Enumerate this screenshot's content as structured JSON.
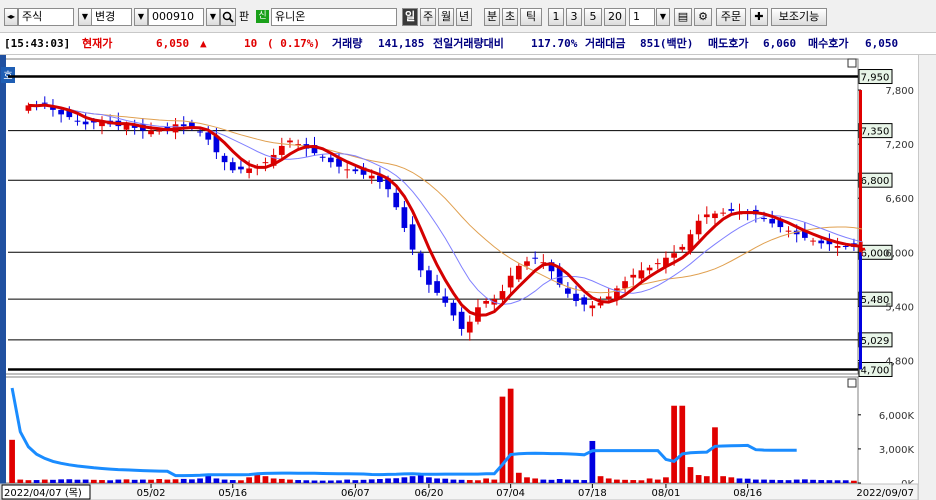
{
  "toolbar": {
    "market_type": "주식",
    "change_button": "변경",
    "stock_code": "000910",
    "search_icon": "search-icon",
    "pan_label": "판",
    "credit_badge": "신",
    "stock_name": "유니온",
    "period_buttons": [
      "일",
      "주",
      "월",
      "년",
      "분",
      "초",
      "틱"
    ],
    "active_period": "일",
    "interval_buttons": [
      "1",
      "3",
      "5",
      "20"
    ],
    "interval_value": "1",
    "order_button": "주문",
    "plus_icon": "plus-icon",
    "aux_button": "보조기능"
  },
  "info": {
    "time": "[15:43:03]",
    "current_label": "현재가",
    "current_price": "6,050",
    "arrow": "▲",
    "change": "10",
    "change_pct": "( 0.17%)",
    "volume_label": "거래량",
    "volume": "141,185",
    "prev_ratio_label": "전일거래량대비",
    "prev_ratio": "117.70%",
    "amount_label": "거래대금",
    "amount": "851(백만)",
    "ask_label": "매도호가",
    "ask": "6,060",
    "bid_label": "매수호가",
    "bid": "6,050"
  },
  "chart_data": {
    "type": "candlestick",
    "price_ticks": [
      "7,800",
      "7,200",
      "6,600",
      "6,000",
      "5,400",
      "4,800"
    ],
    "price_tick_values": [
      7800,
      7200,
      6600,
      6000,
      5400,
      4800
    ],
    "hlines": [
      {
        "label": "7,950",
        "value": 7950
      },
      {
        "label": "7,350",
        "value": 7350
      },
      {
        "label": "6,800",
        "value": 6800
      },
      {
        "label": "6,000",
        "value": 6000
      },
      {
        "label": "5,480",
        "value": 5480
      },
      {
        "label": "5,029",
        "value": 5029
      },
      {
        "label": "4,700",
        "value": 4700
      }
    ],
    "volume_ticks": [
      "6,000K",
      "3,000K",
      "0K"
    ],
    "volume_tick_values": [
      6000,
      3000,
      0
    ],
    "date_labels": [
      "2022/04/07 (목)",
      "05/02",
      "05/16",
      "06/07",
      "06/20",
      "07/04",
      "07/18",
      "08/01",
      "08/16",
      "2022/09/07"
    ],
    "date_label_index": [
      0,
      17,
      27,
      42,
      51,
      61,
      71,
      80,
      90,
      104
    ],
    "n_days": 104,
    "first_candle_index": 2,
    "closes": [
      7630,
      7620,
      7650,
      7580,
      7530,
      7500,
      7450,
      7420,
      7440,
      7460,
      7420,
      7400,
      7420,
      7380,
      7350,
      7350,
      7350,
      7370,
      7420,
      7400,
      7380,
      7330,
      7250,
      7110,
      7000,
      6910,
      6920,
      6930,
      6950,
      7000,
      7080,
      7180,
      7240,
      7200,
      7150,
      7100,
      7050,
      7000,
      6950,
      6920,
      6900,
      6860,
      6850,
      6780,
      6700,
      6500,
      6270,
      6030,
      5800,
      5640,
      5550,
      5440,
      5300,
      5150,
      5230,
      5390,
      5460,
      5480,
      5570,
      5740,
      5850,
      5900,
      5930,
      5890,
      5790,
      5640,
      5540,
      5460,
      5420,
      5410,
      5440,
      5510,
      5600,
      5680,
      5750,
      5800,
      5830,
      5880,
      5940,
      5990,
      6060,
      6200,
      6350,
      6420,
      6430,
      6440,
      6460,
      6450,
      6430,
      6420,
      6370,
      6320,
      6280,
      6240,
      6200,
      6160,
      6130,
      6100,
      6090,
      6070,
      6060,
      6060,
      6050
    ],
    "candles_ohlc_note": "derived from closes",
    "volumes": [
      3800,
      300,
      250,
      260,
      300,
      280,
      320,
      330,
      290,
      300,
      280,
      260,
      240,
      300,
      320,
      280,
      300,
      290,
      350,
      300,
      330,
      360,
      320,
      400,
      700,
      400,
      300,
      260,
      240,
      500,
      900,
      600,
      400,
      360,
      300,
      260,
      240,
      220,
      210,
      220,
      230,
      300,
      250,
      280,
      320,
      350,
      400,
      420,
      500,
      600,
      700,
      500,
      400,
      380,
      300,
      280,
      260,
      240,
      400,
      300,
      7600,
      8300,
      900,
      500,
      400,
      300,
      280,
      350,
      300,
      280,
      260,
      3700,
      600,
      400,
      300,
      280,
      260,
      240,
      400,
      300,
      500,
      6800,
      6800,
      1400,
      700,
      600,
      4900,
      600,
      500,
      400,
      380,
      300,
      300,
      280,
      260,
      250,
      300,
      320,
      280,
      260,
      250,
      240,
      240,
      200
    ],
    "ma_colors": {
      "ma5": "#d40000",
      "ma10": "#8080ff",
      "ma20": "#e0a050"
    },
    "volume_line_color": "#1a8cff",
    "up_color": "#e00000",
    "down_color": "#0000e0"
  }
}
